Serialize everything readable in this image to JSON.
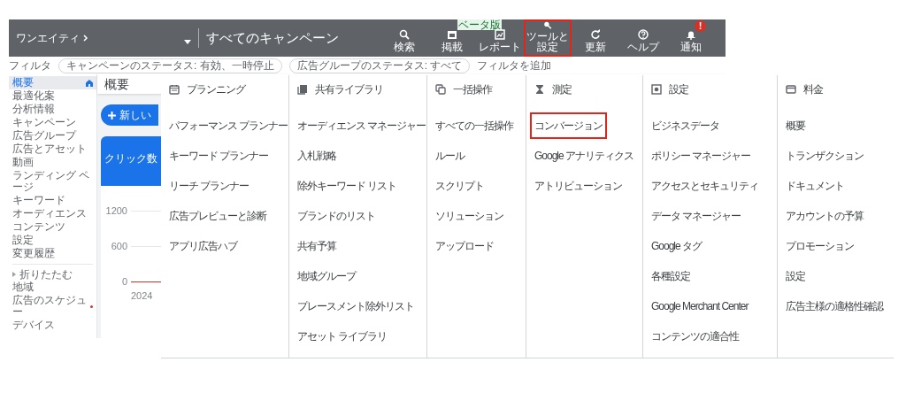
{
  "account": {
    "name": "ワンエイティ"
  },
  "campaign_selector": {
    "title": "すべてのキャンペーン"
  },
  "toolbar": [
    {
      "kind": "search",
      "label": "検索",
      "highlighted": false
    },
    {
      "kind": "display",
      "label": "掲載",
      "highlighted": false,
      "tag": "ベータ版"
    },
    {
      "kind": "report",
      "label": "レポート",
      "highlighted": false
    },
    {
      "kind": "tools",
      "label": "ツールと設定",
      "highlighted": true
    },
    {
      "kind": "refresh",
      "label": "更新",
      "highlighted": false
    },
    {
      "kind": "help",
      "label": "ヘルプ",
      "highlighted": false
    },
    {
      "kind": "bell",
      "label": "通知",
      "highlighted": false,
      "alert": "!"
    }
  ],
  "filters": {
    "label": "フィルタ",
    "chips": [
      "キャンペーンのステータス: 有効、一時停止",
      "広告グループのステータス: すべて"
    ],
    "add": "フィルタを追加"
  },
  "sidebar": {
    "items": [
      {
        "label": "概要",
        "selected": true,
        "alert": false
      },
      {
        "label": "最適化案",
        "selected": false,
        "alert": false
      },
      {
        "label": "分析情報",
        "selected": false,
        "alert": false
      },
      {
        "label": "キャンペーン",
        "selected": false,
        "alert": false
      },
      {
        "label": "広告グループ",
        "selected": false,
        "alert": false
      },
      {
        "label": "広告とアセット",
        "selected": false,
        "alert": false
      },
      {
        "label": "動画",
        "selected": false,
        "alert": false
      },
      {
        "label": "ランディング ページ",
        "selected": false,
        "alert": false
      },
      {
        "label": "キーワード",
        "selected": false,
        "alert": false
      },
      {
        "label": "オーディエンス",
        "selected": false,
        "alert": false
      },
      {
        "label": "コンテンツ",
        "selected": false,
        "alert": false
      },
      {
        "label": "設定",
        "selected": false,
        "alert": false
      },
      {
        "label": "変更履歴",
        "selected": false,
        "alert": false
      }
    ],
    "collapse": {
      "label": "折りたたむ"
    },
    "more_items": [
      {
        "label": "地域",
        "selected": false,
        "alert": false
      },
      {
        "label": "広告のスケジュー",
        "selected": false,
        "alert": true
      },
      {
        "label": "デバイス",
        "selected": false,
        "alert": false
      }
    ]
  },
  "page": {
    "title": "概要",
    "new_button": "新しい",
    "metric": "クリック数",
    "y_labels": [
      "1200",
      "600",
      "0"
    ],
    "x_label": "2024"
  },
  "menu": [
    {
      "kind": "calendar",
      "title": "プランニング",
      "items": [
        {
          "label": "パフォーマンス プランナー",
          "highlighted": false
        },
        {
          "label": "キーワード プランナー",
          "highlighted": false
        },
        {
          "label": "リーチ プランナー",
          "highlighted": false
        },
        {
          "label": "広告プレビューと診断",
          "highlighted": false
        },
        {
          "label": "アプリ広告ハブ",
          "highlighted": false
        }
      ]
    },
    {
      "kind": "library",
      "title": "共有ライブラリ",
      "items": [
        {
          "label": "オーディエンス マネージャー",
          "highlighted": false
        },
        {
          "label": "入札戦略",
          "highlighted": false
        },
        {
          "label": "除外キーワード リスト",
          "highlighted": false
        },
        {
          "label": "ブランドのリスト",
          "highlighted": false
        },
        {
          "label": "共有予算",
          "highlighted": false
        },
        {
          "label": "地域グループ",
          "highlighted": false
        },
        {
          "label": "プレースメント除外リスト",
          "highlighted": false
        },
        {
          "label": "アセット ライブラリ",
          "highlighted": false
        }
      ]
    },
    {
      "kind": "copy",
      "title": "一括操作",
      "items": [
        {
          "label": "すべての一括操作",
          "highlighted": false
        },
        {
          "label": "ルール",
          "highlighted": false
        },
        {
          "label": "スクリプト",
          "highlighted": false
        },
        {
          "label": "ソリューション",
          "highlighted": false
        },
        {
          "label": "アップロード",
          "highlighted": false
        }
      ]
    },
    {
      "kind": "hourglass",
      "title": "測定",
      "items": [
        {
          "label": "コンバージョン",
          "highlighted": true
        },
        {
          "label": "Google アナリティクス",
          "highlighted": false
        },
        {
          "label": "アトリビューション",
          "highlighted": false
        }
      ]
    },
    {
      "kind": "settings",
      "title": "設定",
      "items": [
        {
          "label": "ビジネスデータ",
          "highlighted": false
        },
        {
          "label": "ポリシー マネージャー",
          "highlighted": false
        },
        {
          "label": "アクセスとセキュリティ",
          "highlighted": false
        },
        {
          "label": "データ マネージャー",
          "highlighted": false
        },
        {
          "label": "Google タグ",
          "highlighted": false
        },
        {
          "label": "各種設定",
          "highlighted": false
        },
        {
          "label": "Google Merchant Center",
          "highlighted": false
        },
        {
          "label": "コンテンツの適合性",
          "highlighted": false
        }
      ]
    },
    {
      "kind": "card",
      "title": "料金",
      "items": [
        {
          "label": "概要",
          "highlighted": false
        },
        {
          "label": "トランザクション",
          "highlighted": false
        },
        {
          "label": "ドキュメント",
          "highlighted": false
        },
        {
          "label": "アカウントの予算",
          "highlighted": false
        },
        {
          "label": "プロモーション",
          "highlighted": false
        },
        {
          "label": "設定",
          "highlighted": false
        },
        {
          "label": "広告主様の適格性確認",
          "highlighted": false
        }
      ]
    }
  ]
}
